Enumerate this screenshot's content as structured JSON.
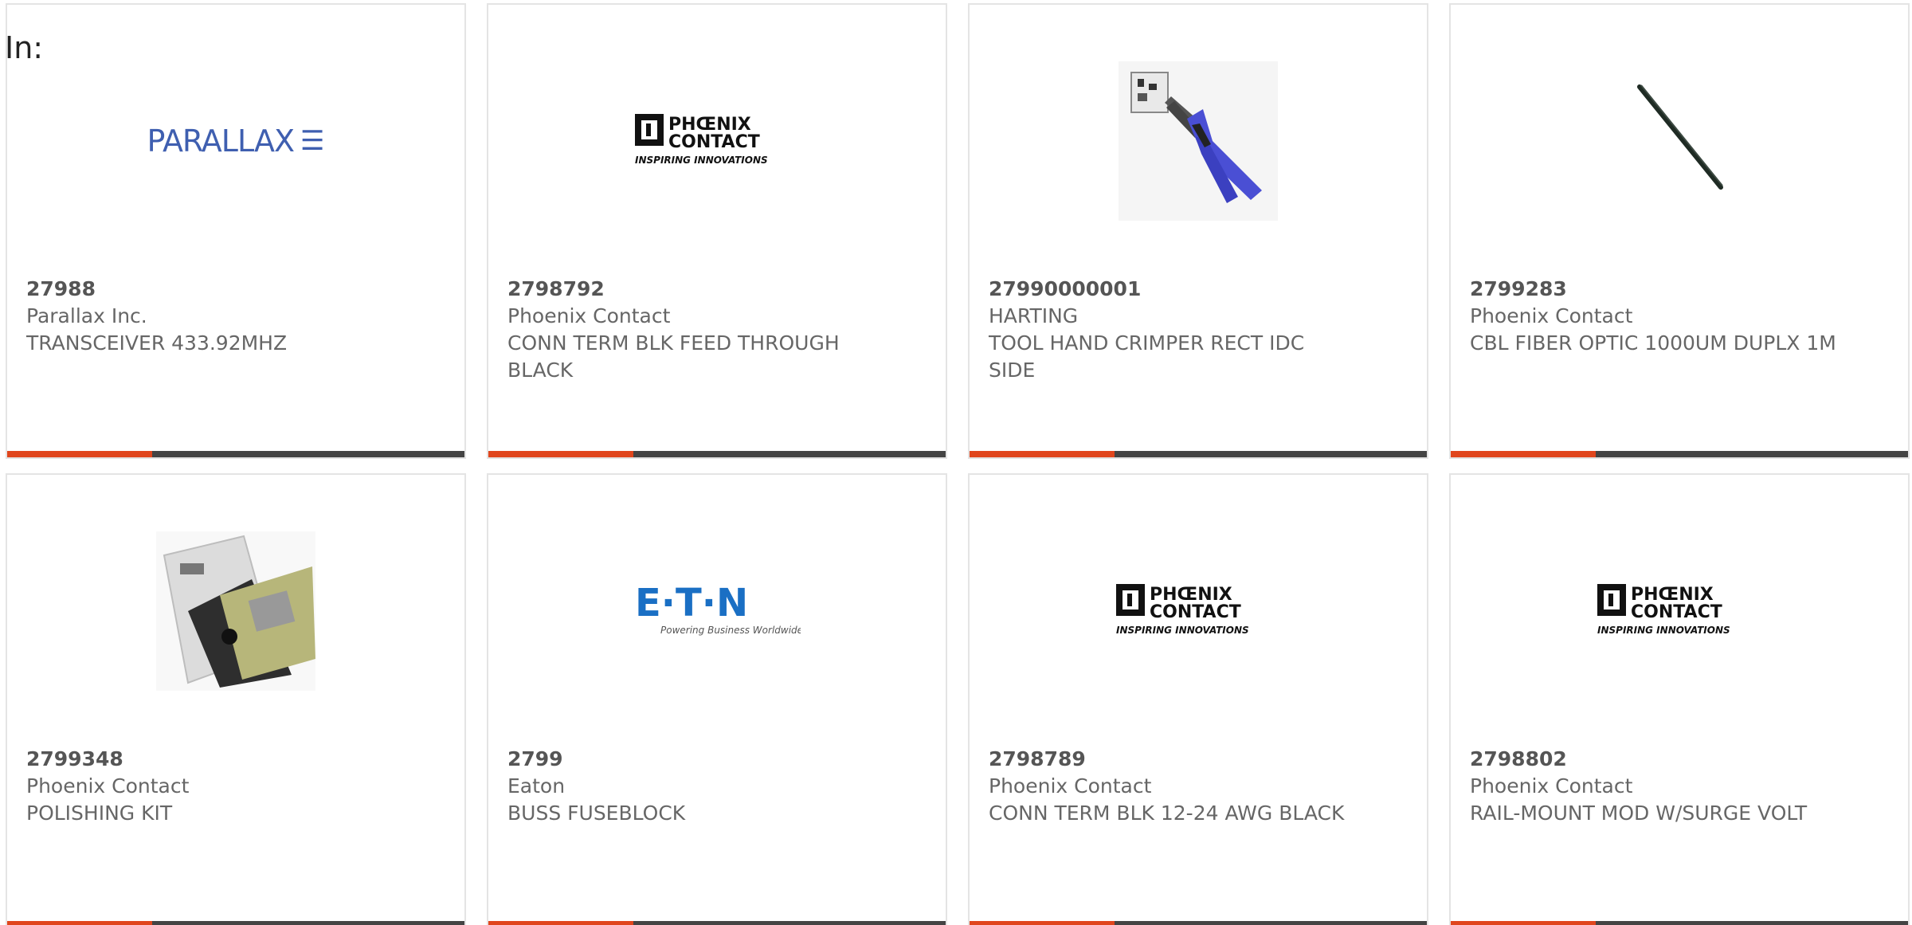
{
  "heading": "In:",
  "colors": {
    "accent": "#e0461d",
    "bar": "#444444",
    "text": "#666666"
  },
  "cards": [
    {
      "part_number": "27988",
      "manufacturer": "Parallax Inc.",
      "description": "TRANSCEIVER 433.92MHZ",
      "image": "parallax-logo",
      "logo_text": "PARALLAX"
    },
    {
      "part_number": "2798792",
      "manufacturer": "Phoenix Contact",
      "description": "CONN TERM BLK FEED THROUGH BLACK",
      "image": "phoenix-contact-logo",
      "logo_line1": "PHŒNIX",
      "logo_line2": "CONTACT",
      "logo_tagline": "INSPIRING INNOVATIONS"
    },
    {
      "part_number": "27990000001",
      "manufacturer": "HARTING",
      "description": "TOOL HAND CRIMPER RECT IDC SIDE",
      "image": "crimper-tool-photo"
    },
    {
      "part_number": "2799283",
      "manufacturer": "Phoenix Contact",
      "description": "CBL FIBER OPTIC 1000UM DUPLX 1M",
      "image": "fiber-cable-photo"
    },
    {
      "part_number": "2799348",
      "manufacturer": "Phoenix Contact",
      "description": "POLISHING KIT",
      "image": "polishing-kit-photo"
    },
    {
      "part_number": "2799",
      "manufacturer": "Eaton",
      "description": "BUSS FUSEBLOCK",
      "image": "eaton-logo",
      "logo_text": "E·T·N",
      "logo_tagline": "Powering Business Worldwide"
    },
    {
      "part_number": "2798789",
      "manufacturer": "Phoenix Contact",
      "description": "CONN TERM BLK 12-24 AWG BLACK",
      "image": "phoenix-contact-logo",
      "logo_line1": "PHŒNIX",
      "logo_line2": "CONTACT",
      "logo_tagline": "INSPIRING INNOVATIONS"
    },
    {
      "part_number": "2798802",
      "manufacturer": "Phoenix Contact",
      "description": "RAIL-MOUNT MOD W/SURGE VOLT",
      "image": "phoenix-contact-logo",
      "logo_line1": "PHŒNIX",
      "logo_line2": "CONTACT",
      "logo_tagline": "INSPIRING INNOVATIONS"
    }
  ]
}
